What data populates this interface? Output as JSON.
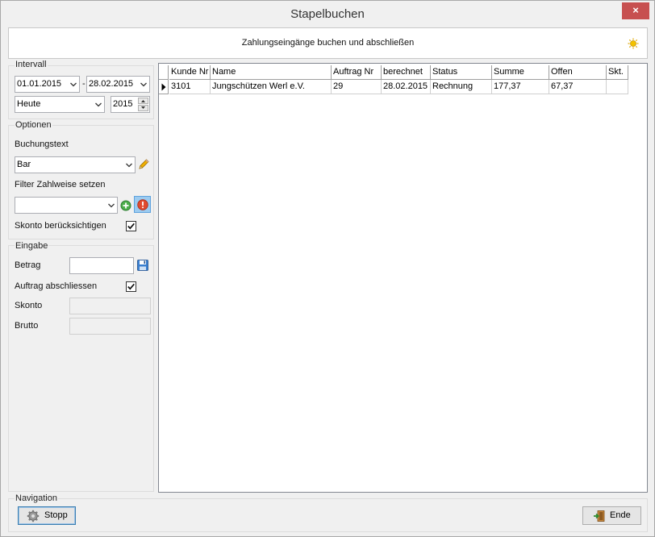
{
  "window": {
    "title": "Stapelbuchen",
    "close_label": "×",
    "subtitle": "Zahlungseingänge buchen und abschließen"
  },
  "intervall": {
    "group_label": "Intervall",
    "date_from": "01.01.2015",
    "separator": "-",
    "date_to": "28.02.2015",
    "period": "Heute",
    "year": "2015"
  },
  "optionen": {
    "group_label": "Optionen",
    "buchungstext_label": "Buchungstext",
    "buchungstext_value": "Bar",
    "filter_label": "Filter Zahlweise setzen",
    "filter_value": "",
    "skonto_label": "Skonto berücksichtigen",
    "skonto_checked": true
  },
  "eingabe": {
    "group_label": "Eingabe",
    "betrag_label": "Betrag",
    "betrag_value": "",
    "auftrag_label": "Auftrag abschliessen",
    "auftrag_checked": true,
    "skonto_label": "Skonto",
    "brutto_label": "Brutto"
  },
  "table": {
    "columns": [
      "Kunde Nr",
      "Name",
      "Auftrag Nr",
      "berechnet",
      "Status",
      "Summe",
      "Offen",
      "Skt."
    ],
    "rows": [
      [
        "3101",
        "Jungschützen Werl e.V.",
        "29",
        "28.02.2015",
        "Rechnung",
        "177,37",
        "67,37",
        ""
      ]
    ]
  },
  "navigation": {
    "group_label": "Navigation",
    "stop_label": "Stopp",
    "end_label": "Ende"
  },
  "icons": {
    "header_icon": "sun-icon",
    "edit_icon": "pencil-icon",
    "add_icon": "add-icon",
    "remove_icon": "stop-icon",
    "save_icon": "save-icon",
    "stop_button_icon": "gear-icon",
    "end_button_icon": "exit-icon"
  }
}
